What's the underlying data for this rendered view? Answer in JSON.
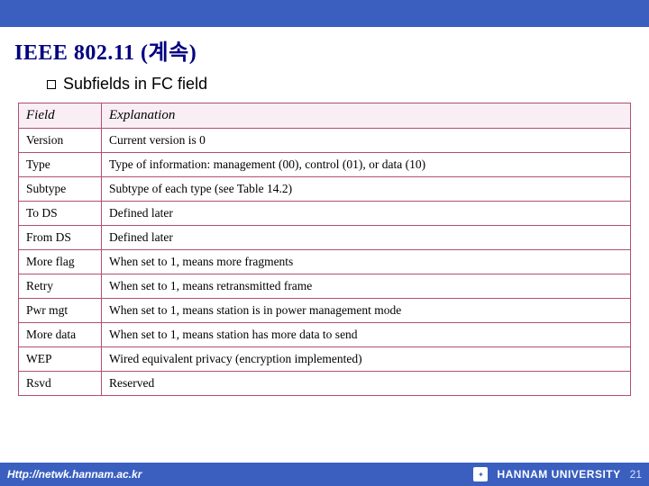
{
  "title": "IEEE 802.11 (계속)",
  "subtitle": "Subfields in FC field",
  "headers": {
    "field": "Field",
    "explanation": "Explanation"
  },
  "rows": [
    {
      "f": "Version",
      "e": "Current version is 0"
    },
    {
      "f": "Type",
      "e": "Type of information: management (00), control (01), or data (10)"
    },
    {
      "f": "Subtype",
      "e": "Subtype of each type (see Table 14.2)"
    },
    {
      "f": "To DS",
      "e": "Defined later"
    },
    {
      "f": "From DS",
      "e": "Defined later"
    },
    {
      "f": "More flag",
      "e": "When set to 1, means more fragments"
    },
    {
      "f": "Retry",
      "e": "When set to 1, means retransmitted frame"
    },
    {
      "f": "Pwr mgt",
      "e": "When set to 1, means station is in power management mode"
    },
    {
      "f": "More data",
      "e": "When set to 1, means station has more data to send"
    },
    {
      "f": "WEP",
      "e": "Wired equivalent privacy (encryption implemented)"
    },
    {
      "f": "Rsvd",
      "e": "Reserved"
    }
  ],
  "footer": {
    "url": "Http://netwk.hannam.ac.kr",
    "university": "HANNAM  UNIVERSITY",
    "page": "21"
  }
}
